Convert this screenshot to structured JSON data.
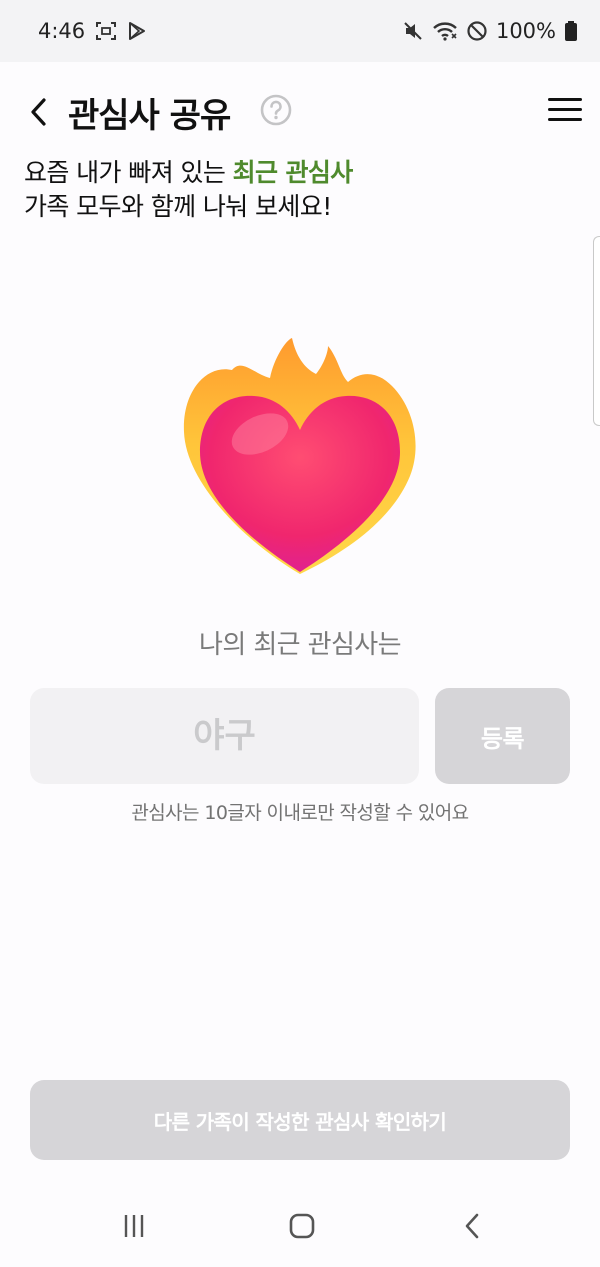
{
  "status_bar": {
    "time": "4:46",
    "battery": "100%",
    "icons": [
      "screenshot-icon",
      "play-store-icon",
      "mute-icon",
      "wifi-icon",
      "do-not-disturb-icon",
      "battery-icon"
    ]
  },
  "header": {
    "title": "관심사 공유",
    "back_icon": "back-arrow-icon",
    "help_icon": "question-circle-icon",
    "menu_icon": "hamburger-menu-icon"
  },
  "intro": {
    "line1_prefix": "요즘 내가 빠져 있는 ",
    "line1_highlight": "최근 관심사",
    "line2": "가족 모두와 함께 나눠 보세요!"
  },
  "illustration": {
    "icon": "heart-on-fire-icon"
  },
  "form": {
    "prompt": "나의 최근 관심사는",
    "input_value": "",
    "input_placeholder": "야구",
    "register_label": "등록",
    "hint": "관심사는 10글자 이내로만 작성할 수 있어요"
  },
  "footer": {
    "view_others_label": "다른 가족이 작성한 관심사 확인하기"
  },
  "nav": {
    "icons": [
      "recent-apps-icon",
      "home-icon",
      "system-back-icon"
    ]
  },
  "colors": {
    "accent_green": "#4f8a2d",
    "disabled_button": "#d6d5d8",
    "input_bg": "#f2f1f3"
  }
}
